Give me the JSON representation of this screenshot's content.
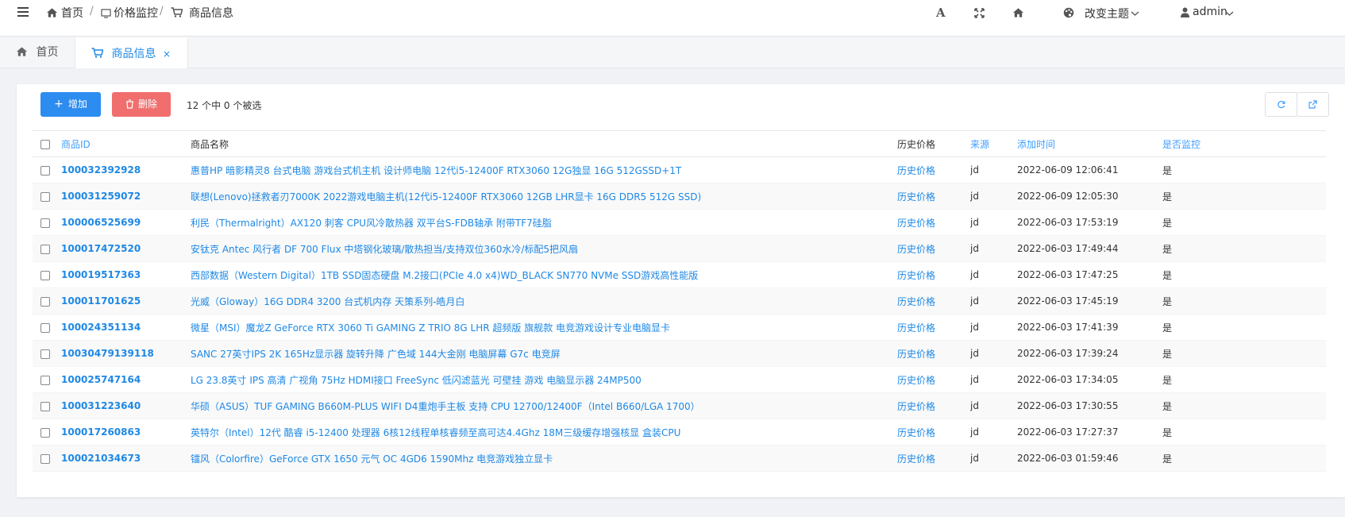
{
  "header": {
    "breadcrumb": [
      "首页",
      "价格监控",
      "商品信息"
    ],
    "separator": "/",
    "theme_label": "改变主题",
    "user": "admin"
  },
  "tabs": [
    {
      "label": "首页"
    },
    {
      "label": "商品信息",
      "close": "×"
    }
  ],
  "toolbar": {
    "add_label": "增加",
    "delete_label": "删除",
    "selection_info": "12 个中 0 个被选"
  },
  "table": {
    "columns": [
      "商品ID",
      "商品名称",
      "历史价格",
      "来源",
      "添加时间",
      "是否监控"
    ],
    "rows": [
      {
        "id": "100032392928",
        "name": "惠普HP 暗影精灵8 台式电脑 游戏台式机主机 设计师电脑 12代i5-12400F RTX3060 12G独显 16G 512GSSD+1T",
        "history": "历史价格",
        "source": "jd",
        "time": "2022-06-09 12:06:41",
        "monitor": "是"
      },
      {
        "id": "100031259072",
        "name": "联想(Lenovo)拯救者刃7000K 2022游戏电脑主机(12代i5-12400F RTX3060 12GB LHR显卡 16G DDR5 512G SSD)",
        "history": "历史价格",
        "source": "jd",
        "time": "2022-06-09 12:05:30",
        "monitor": "是"
      },
      {
        "id": "100006525699",
        "name": "利民（Thermalright）AX120 刺客 CPU风冷散热器 双平台S-FDB轴承 附带TF7硅脂",
        "history": "历史价格",
        "source": "jd",
        "time": "2022-06-03 17:53:19",
        "monitor": "是"
      },
      {
        "id": "100017472520",
        "name": "安钛克 Antec 风行者 DF 700 Flux 中塔钢化玻璃/散热担当/支持双位360水冷/标配5把风扇",
        "history": "历史价格",
        "source": "jd",
        "time": "2022-06-03 17:49:44",
        "monitor": "是"
      },
      {
        "id": "100019517363",
        "name": "西部数据（Western Digital）1TB SSD固态硬盘 M.2接口(PCIe 4.0 x4)WD_BLACK SN770 NVMe SSD游戏高性能版",
        "history": "历史价格",
        "source": "jd",
        "time": "2022-06-03 17:47:25",
        "monitor": "是"
      },
      {
        "id": "100011701625",
        "name": "光威（Gloway）16G DDR4 3200 台式机内存 天策系列-皓月白",
        "history": "历史价格",
        "source": "jd",
        "time": "2022-06-03 17:45:19",
        "monitor": "是"
      },
      {
        "id": "100024351134",
        "name": "微星（MSI）魔龙Z GeForce RTX 3060 Ti GAMING Z TRIO 8G LHR 超频版 旗舰款 电竞游戏设计专业电脑显卡",
        "history": "历史价格",
        "source": "jd",
        "time": "2022-06-03 17:41:39",
        "monitor": "是"
      },
      {
        "id": "10030479139118",
        "name": "SANC 27英寸IPS 2K 165Hz显示器 旋转升降 广色域 144大金刚 电脑屏幕 G7c 电竞屏",
        "history": "历史价格",
        "source": "jd",
        "time": "2022-06-03 17:39:24",
        "monitor": "是"
      },
      {
        "id": "100025747164",
        "name": "LG 23.8英寸 IPS 高清 广视角 75Hz HDMI接口 FreeSync 低闪滤蓝光 可壁挂 游戏 电脑显示器 24MP500",
        "history": "历史价格",
        "source": "jd",
        "time": "2022-06-03 17:34:05",
        "monitor": "是"
      },
      {
        "id": "100031223640",
        "name": "华硕（ASUS）TUF GAMING B660M-PLUS WIFI D4重炮手主板 支持 CPU 12700/12400F（Intel B660/LGA 1700）",
        "history": "历史价格",
        "source": "jd",
        "time": "2022-06-03 17:30:55",
        "monitor": "是"
      },
      {
        "id": "100017260863",
        "name": "英特尔（Intel）12代 酷睿 i5-12400 处理器 6核12线程单核睿频至高可达4.4Ghz 18M三级缓存增强核显 盒装CPU",
        "history": "历史价格",
        "source": "jd",
        "time": "2022-06-03 17:27:37",
        "monitor": "是"
      },
      {
        "id": "100021034673",
        "name": "镭风（Colorfire）GeForce GTX 1650 元气 OC 4GD6 1590Mhz 电竞游戏独立显卡",
        "history": "历史价格",
        "source": "jd",
        "time": "2022-06-03 01:59:46",
        "monitor": "是"
      }
    ]
  },
  "colors": {
    "accent": "#1e88e5",
    "add": "#2d8cf0",
    "delete": "#f06e6e"
  }
}
